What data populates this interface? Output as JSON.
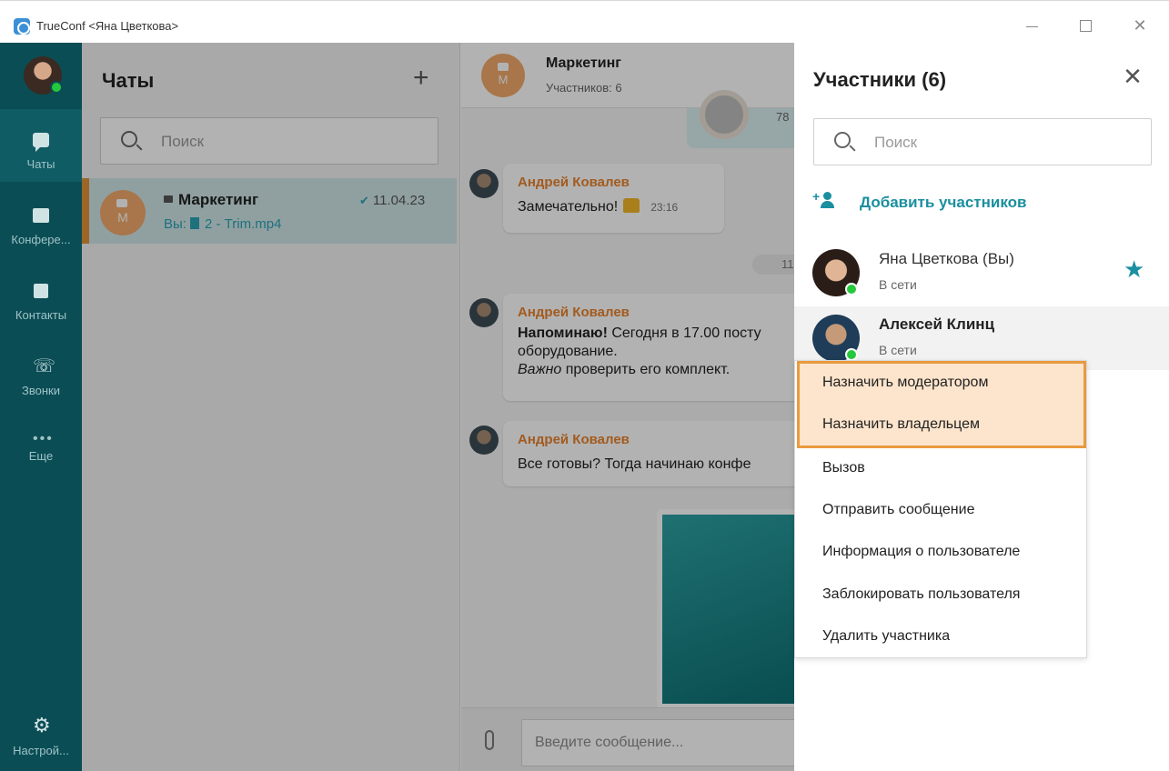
{
  "window": {
    "title": "TrueConf <Яна Цветкова>"
  },
  "nav": {
    "items": [
      {
        "label": "Чаты",
        "icon": "chat-icon"
      },
      {
        "label": "Конфере...",
        "icon": "conference-icon"
      },
      {
        "label": "Контакты",
        "icon": "contacts-icon"
      },
      {
        "label": "Звонки",
        "icon": "calls-icon"
      },
      {
        "label": "Еще",
        "icon": "more-icon"
      }
    ],
    "settings_label": "Настрой..."
  },
  "chats": {
    "title": "Чаты",
    "search_placeholder": "Поиск",
    "items": [
      {
        "name": "Маркетинг",
        "avatar_letter": "М",
        "date": "11.04.23",
        "last_prefix": "Вы:",
        "last_file": "2 - Trim.mp4"
      }
    ]
  },
  "conversation": {
    "title": "Маркетинг",
    "subtitle": "Участников: 6",
    "avatar_letter": "М",
    "top_time_partial": "78",
    "date_partial": "11",
    "messages": [
      {
        "author": "Андрей Ковалев",
        "text": "Замечательно!",
        "time": "23:16"
      },
      {
        "author": "Андрей Ковалев",
        "bold_lead": "Напоминаю!",
        "line1": " Сегодня в 17.00 посту",
        "line2": "оборудование.",
        "italic_lead": "Важно",
        "line3": " проверить его комплект."
      },
      {
        "author": "Андрей Ковалев",
        "text": "Все готовы? Тогда начинаю конфе"
      }
    ],
    "input_placeholder": "Введите сообщение..."
  },
  "participants": {
    "title": "Участники (6)",
    "search_placeholder": "Поиск",
    "add_label": "Добавить участников",
    "members": [
      {
        "name": "Яна Цветкова (Вы)",
        "status": "В сети",
        "owner": true
      },
      {
        "name": "Алексей Клинц",
        "status": "В сети",
        "owner": false
      }
    ]
  },
  "context_menu": {
    "items": [
      "Назначить модератором",
      "Назначить владельцем",
      "Вызов",
      "Отправить сообщение",
      "Информация о пользователе",
      "Заблокировать пользователя",
      "Удалить участника"
    ]
  },
  "colors": {
    "nav_bg": "#0b4d55",
    "accent": "#1a8fa0",
    "author": "#e8832d",
    "highlight_border": "#e99a3f",
    "online": "#25c93b"
  }
}
